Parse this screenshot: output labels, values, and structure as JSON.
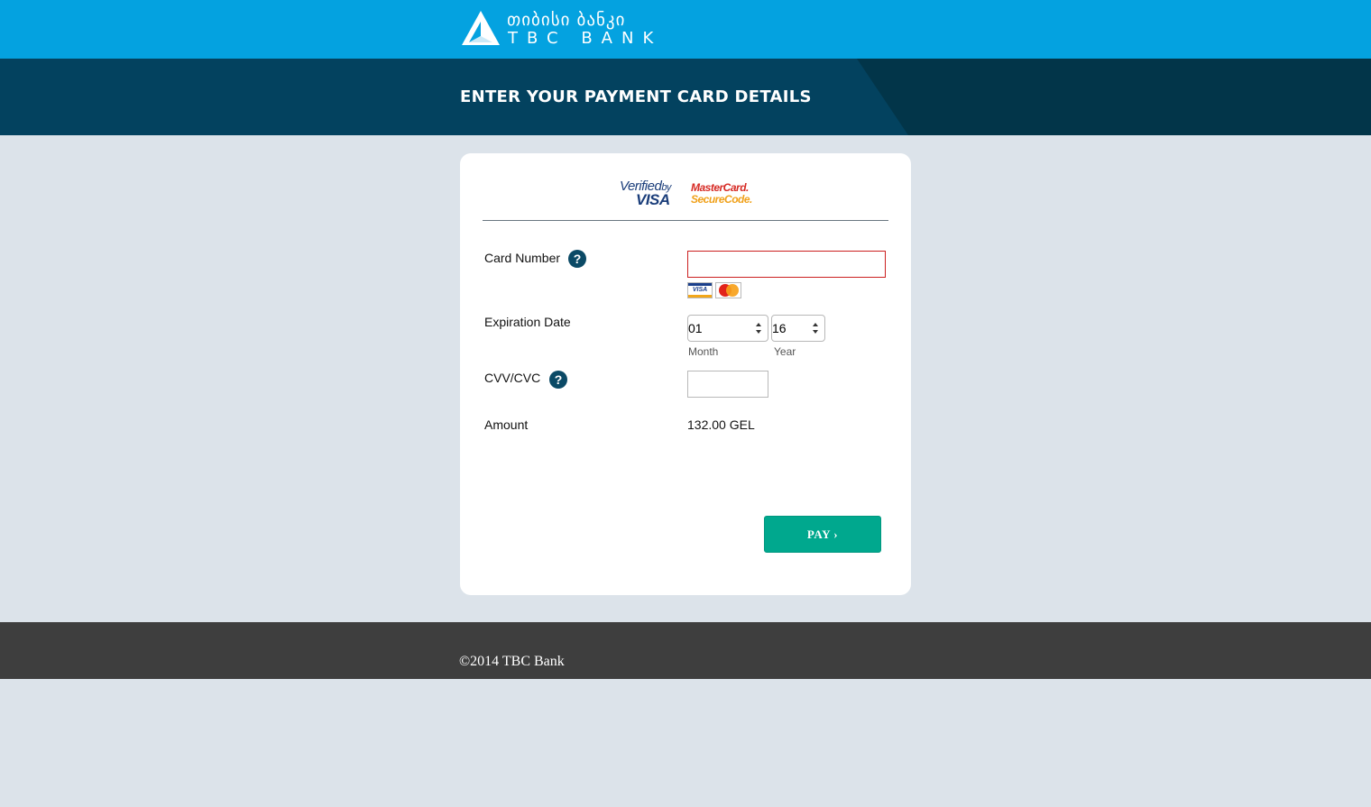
{
  "header": {
    "logo_georgian": "თიბისი ბანკი",
    "logo_english": "TBC BANK",
    "page_title": "ENTER YOUR PAYMENT CARD DETAILS"
  },
  "card": {
    "verified_by_visa": {
      "line1": "Verified",
      "by": "by",
      "line2": "VISA"
    },
    "mastercard_securecode": {
      "line1": "MasterCard.",
      "line2": "SecureCode."
    },
    "card_number": {
      "label": "Card Number",
      "value": "",
      "help": "?"
    },
    "mini_card_logos": {
      "visa": "VISA"
    },
    "expiration_date": {
      "label": "Expiration Date",
      "month": {
        "value": "01",
        "label": "Month"
      },
      "year": {
        "value": "16",
        "label": "Year"
      }
    },
    "cvv": {
      "label": "CVV/CVC",
      "value": "",
      "help": "?"
    },
    "amount": {
      "label": "Amount",
      "value": "132.00 GEL"
    },
    "pay_button": "PAY ›"
  },
  "footer": {
    "copyright": "©2014 TBC Bank"
  },
  "colors": {
    "topbar": "#04a2e0",
    "titlebar": "#03425f",
    "page_bg": "#dce3ea",
    "pay_button": "#00a88e",
    "footer": "#3e3e3e",
    "input_error_border": "#cc1f1f"
  }
}
